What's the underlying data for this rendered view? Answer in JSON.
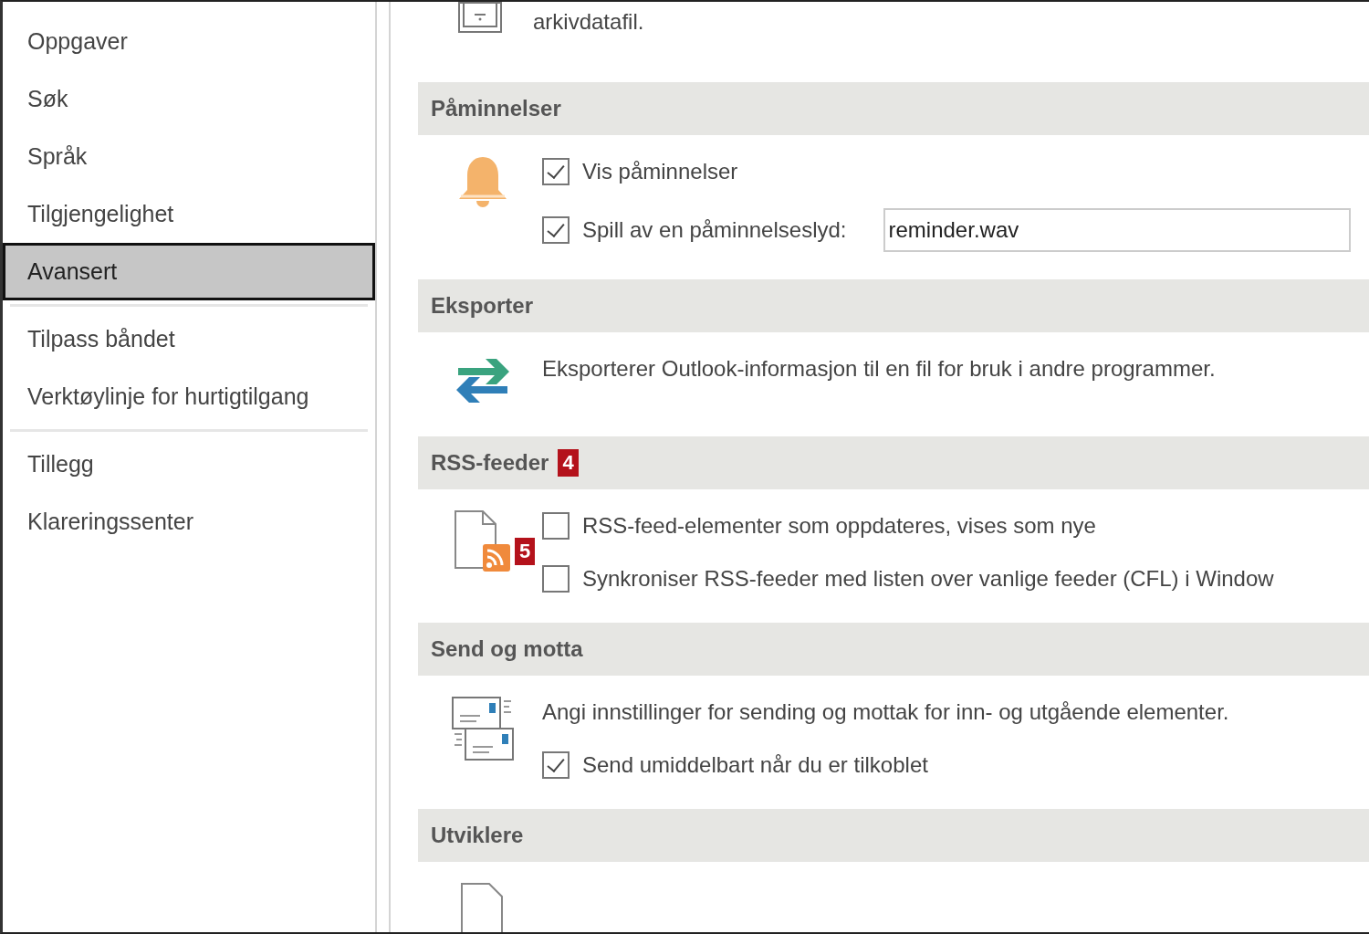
{
  "sidebar": {
    "groups": [
      {
        "items": [
          {
            "label": "Oppgaver",
            "selected": false
          },
          {
            "label": "Søk",
            "selected": false
          },
          {
            "label": "Språk",
            "selected": false
          },
          {
            "label": "Tilgjengelighet",
            "selected": false
          },
          {
            "label": "Avansert",
            "selected": true
          }
        ]
      },
      {
        "items": [
          {
            "label": "Tilpass båndet",
            "selected": false
          },
          {
            "label": "Verktøylinje for hurtigtilgang",
            "selected": false
          }
        ]
      },
      {
        "items": [
          {
            "label": "Tillegg",
            "selected": false
          },
          {
            "label": "Klareringssenter",
            "selected": false
          }
        ]
      }
    ]
  },
  "top_fragment": {
    "text": "arkivdatafil."
  },
  "sections": [
    {
      "title": "Påminnelser",
      "kind": "reminders",
      "rows": [
        {
          "kind": "checkbox",
          "label": "Vis påminnelser",
          "checked": true
        },
        {
          "kind": "checkbox_field",
          "label": "Spill av en påminnelseslyd:",
          "checked": true,
          "value": "reminder.wav"
        }
      ]
    },
    {
      "title": "Eksporter",
      "kind": "export",
      "rows": [
        {
          "kind": "text",
          "text": "Eksporterer Outlook-informasjon til en fil for bruk i andre programmer."
        }
      ]
    },
    {
      "title": "RSS-feeder",
      "kind": "rss",
      "callout": "4",
      "icon_callout": "5",
      "rows": [
        {
          "kind": "checkbox",
          "label": "RSS-feed-elementer som oppdateres, vises som nye",
          "checked": false
        },
        {
          "kind": "checkbox",
          "label": "Synkroniser RSS-feeder med listen over vanlige feeder (CFL) i Window",
          "checked": false
        }
      ]
    },
    {
      "title": "Send og motta",
      "kind": "sendreceive",
      "rows": [
        {
          "kind": "text",
          "text": "Angi innstillinger for sending og mottak for inn- og utgående elementer."
        },
        {
          "kind": "checkbox",
          "label": "Send umiddelbart når du er tilkoblet",
          "checked": true
        }
      ]
    },
    {
      "title": "Utviklere",
      "kind": "developers"
    }
  ]
}
